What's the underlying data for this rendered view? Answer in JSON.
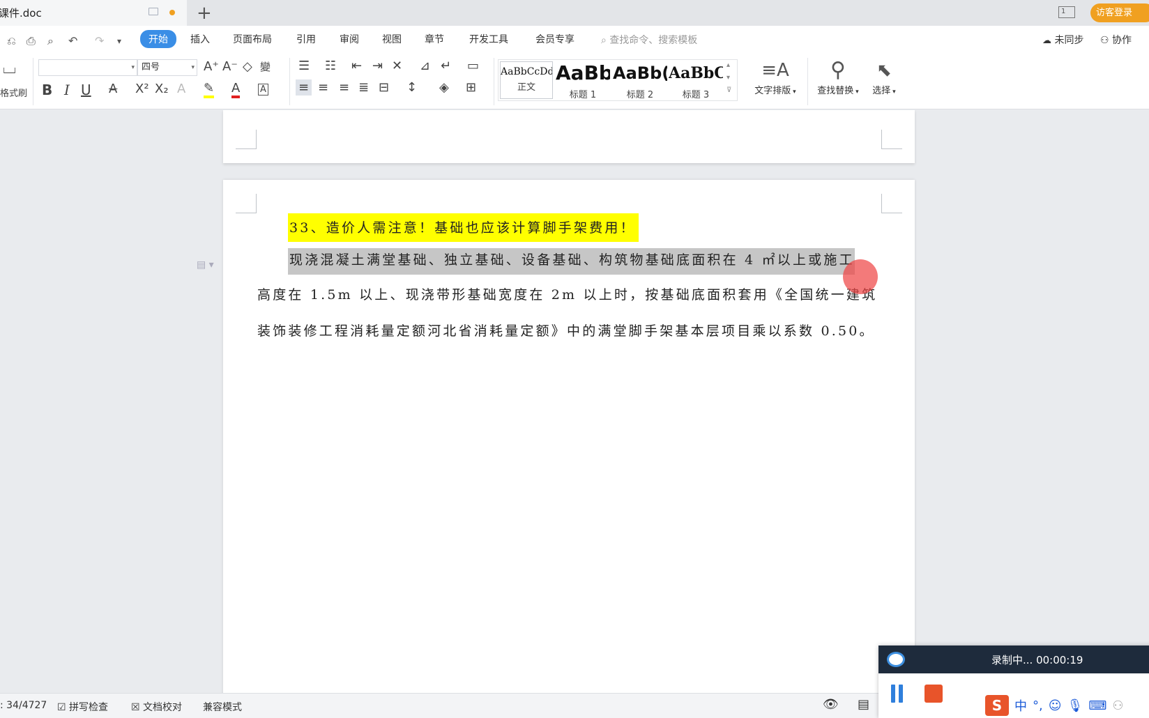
{
  "titlebar": {
    "tab_title": "课件.doc",
    "login_label": "访客登录"
  },
  "menubar": {
    "items": [
      "开始",
      "插入",
      "页面布局",
      "引用",
      "审阅",
      "视图",
      "章节",
      "开发工具",
      "会员专享"
    ],
    "search_placeholder": "查找命令、搜索模板",
    "sync_label": "未同步",
    "collab_label": "协作"
  },
  "ribbon": {
    "format_painter_label": "格式刷",
    "font_size": "四号",
    "styles": [
      {
        "sample": "AaBbCcDd",
        "label": "正文"
      },
      {
        "sample": "AaBb",
        "label": "标题 1"
      },
      {
        "sample": "AaBb(",
        "label": "标题 2"
      },
      {
        "sample": "AaBbC",
        "label": "标题 3"
      }
    ],
    "text_layout_label": "文字排版",
    "find_replace_label": "查找替换",
    "select_label": "选择"
  },
  "document": {
    "heading": "33、造价人需注意！基础也应该计算脚手架费用！",
    "line1": "现浇混凝土满堂基础、独立基础、设备基础、构筑物基础底面积在 4 ㎡以上或施工",
    "line2": "高度在 1.5m 以上、现浇带形基础宽度在 2m 以上时，按基础底面积套用《全国统一建筑",
    "line3": "装饰装修工程消耗量定额河北省消耗量定额》中的满堂脚手架基本层项目乘以系数 0.50。"
  },
  "statusbar": {
    "word_count": ": 34/4727",
    "spell_check": "拼写检查",
    "doc_proof": "文档校对",
    "compat_mode": "兼容模式"
  },
  "recorder": {
    "status": "录制中... 00:00:19"
  },
  "ime": {
    "lang": "中"
  }
}
